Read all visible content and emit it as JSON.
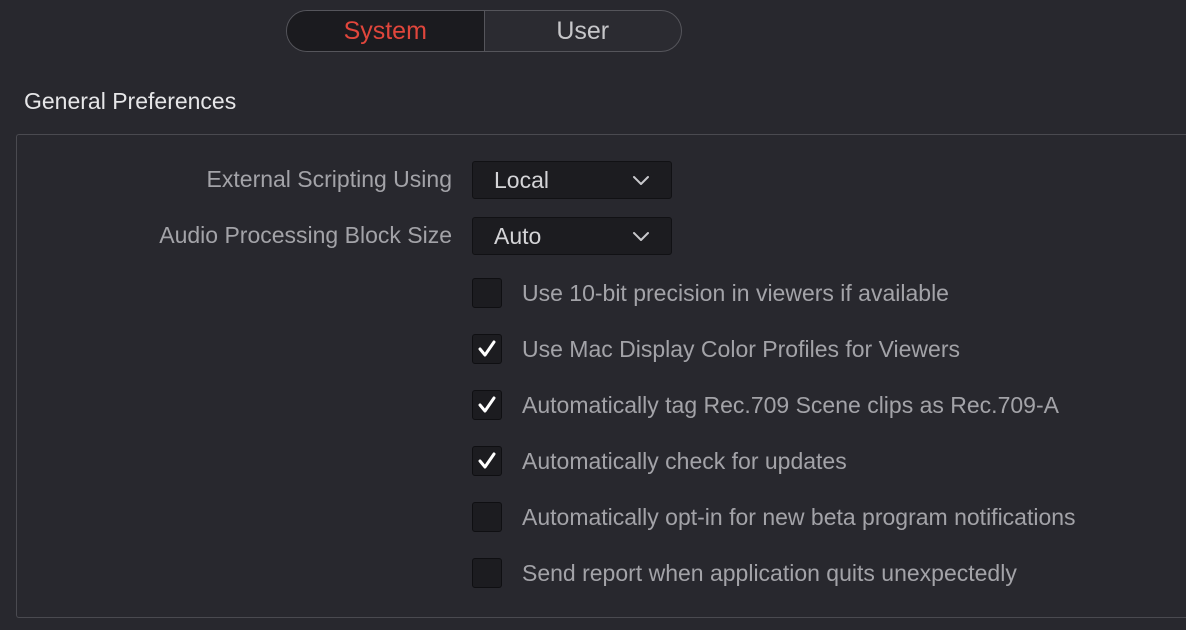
{
  "tabs": {
    "system_label": "System",
    "user_label": "User",
    "active": "System"
  },
  "section": {
    "title": "General Preferences"
  },
  "settings": {
    "external_scripting": {
      "label": "External Scripting Using",
      "value": "Local"
    },
    "audio_block_size": {
      "label": "Audio Processing Block Size",
      "value": "Auto"
    }
  },
  "checkboxes": [
    {
      "label": "Use 10-bit precision in viewers if available",
      "checked": false
    },
    {
      "label": "Use Mac Display Color Profiles for Viewers",
      "checked": true
    },
    {
      "label": "Automatically tag Rec.709 Scene clips as Rec.709-A",
      "checked": true
    },
    {
      "label": "Automatically check for updates",
      "checked": true
    },
    {
      "label": "Automatically opt-in for new beta program notifications",
      "checked": false
    },
    {
      "label": "Send report when application quits unexpectedly",
      "checked": false
    }
  ],
  "icons": {
    "chevron": "chevron-down-icon",
    "checkmark": "checkmark-icon"
  },
  "colors": {
    "background": "#28282e",
    "accent": "#e0463c",
    "text_primary": "#e6e6e8",
    "text_secondary": "#a3a3a8",
    "control_bg": "#1c1c20"
  }
}
